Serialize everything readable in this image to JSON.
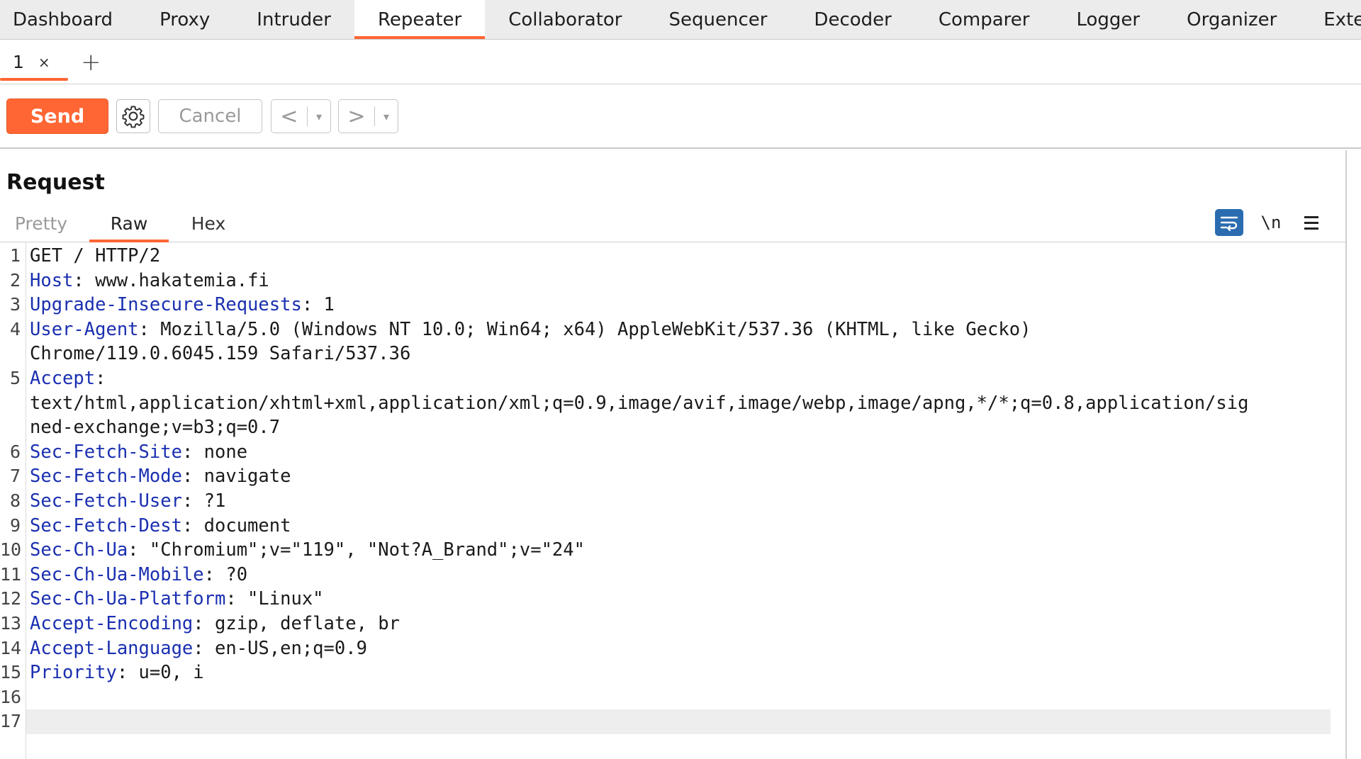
{
  "topnav": {
    "tabs": [
      "Dashboard",
      "Proxy",
      "Intruder",
      "Repeater",
      "Collaborator",
      "Sequencer",
      "Decoder",
      "Comparer",
      "Logger",
      "Organizer",
      "Exter"
    ],
    "active": "Repeater"
  },
  "subtabs": {
    "tab_label": "1",
    "close_glyph": "×",
    "add_glyph": "+"
  },
  "toolbar": {
    "send_label": "Send",
    "cancel_label": "Cancel",
    "back_glyph": "<",
    "forward_glyph": ">",
    "dropdown_glyph": "▾",
    "settings_icon": "gear-icon"
  },
  "request": {
    "title": "Request",
    "view_tabs": {
      "pretty": "Pretty",
      "raw": "Raw",
      "hex": "Hex"
    },
    "active_view": "Raw",
    "icons": {
      "wrap": "wrap-lines-icon",
      "newline": "\\n",
      "menu": "hamburger-menu-icon"
    },
    "lines": [
      {
        "n": "1",
        "text": "GET / HTTP/2"
      },
      {
        "n": "2",
        "key": "Host",
        "val": " www.hakatemia.fi"
      },
      {
        "n": "3",
        "key": "Upgrade-Insecure-Requests",
        "val": " 1"
      },
      {
        "n": "4",
        "key": "User-Agent",
        "val": " Mozilla/5.0 (Windows NT 10.0; Win64; x64) AppleWebKit/537.36 (KHTML, like Gecko)"
      },
      {
        "n": "",
        "text": "Chrome/119.0.6045.159 Safari/537.36"
      },
      {
        "n": "5",
        "key": "Accept",
        "val": ""
      },
      {
        "n": "",
        "text": "text/html,application/xhtml+xml,application/xml;q=0.9,image/avif,image/webp,image/apng,*/*;q=0.8,application/sig"
      },
      {
        "n": "",
        "text": "ned-exchange;v=b3;q=0.7"
      },
      {
        "n": "6",
        "key": "Sec-Fetch-Site",
        "val": " none"
      },
      {
        "n": "7",
        "key": "Sec-Fetch-Mode",
        "val": " navigate"
      },
      {
        "n": "8",
        "key": "Sec-Fetch-User",
        "val": " ?1"
      },
      {
        "n": "9",
        "key": "Sec-Fetch-Dest",
        "val": " document"
      },
      {
        "n": "10",
        "key": "Sec-Ch-Ua",
        "val": " \"Chromium\";v=\"119\", \"Not?A_Brand\";v=\"24\""
      },
      {
        "n": "11",
        "key": "Sec-Ch-Ua-Mobile",
        "val": " ?0"
      },
      {
        "n": "12",
        "key": "Sec-Ch-Ua-Platform",
        "val": " \"Linux\""
      },
      {
        "n": "13",
        "key": "Accept-Encoding",
        "val": " gzip, deflate, br"
      },
      {
        "n": "14",
        "key": "Accept-Language",
        "val": " en-US,en;q=0.9"
      },
      {
        "n": "15",
        "key": "Priority",
        "val": " u=0, i"
      },
      {
        "n": "16",
        "text": ""
      },
      {
        "n": "17",
        "text": ""
      }
    ],
    "current_line": "17"
  },
  "colors": {
    "accent": "#ff6633",
    "header_key": "#1a2fb0",
    "icon_active": "#2b6cb0"
  }
}
